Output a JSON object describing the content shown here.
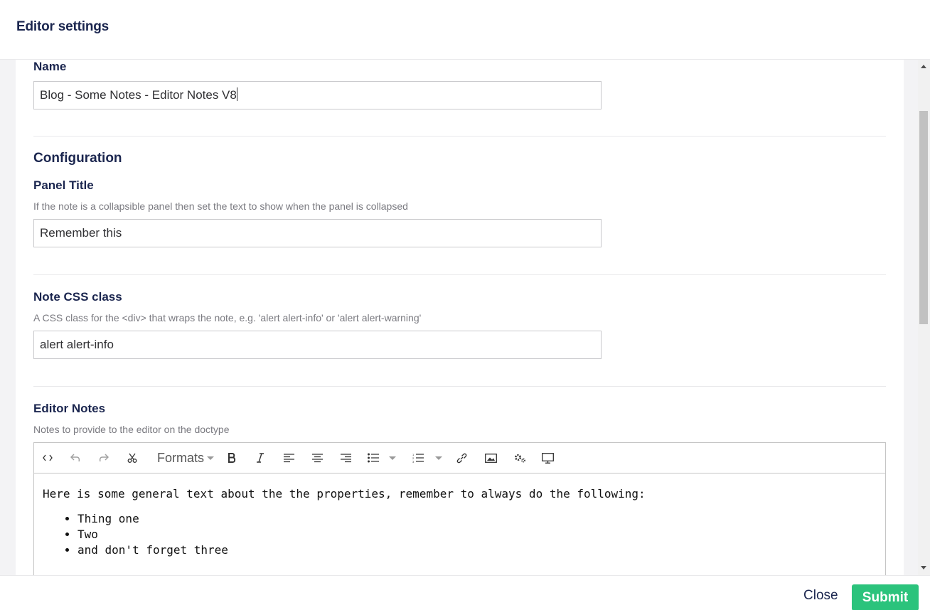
{
  "header": {
    "title": "Editor settings"
  },
  "name_field": {
    "label": "Name",
    "value": "Blog - Some Notes - Editor Notes V8"
  },
  "configuration": {
    "title": "Configuration"
  },
  "panel_title": {
    "label": "Panel Title",
    "description": "If the note is a collapsible panel then set the text to show when the panel is collapsed",
    "value": "Remember this"
  },
  "note_css": {
    "label": "Note CSS class",
    "description": "A CSS class for the <div> that wraps the note, e.g. 'alert alert-info' or 'alert alert-warning'",
    "value": "alert alert-info"
  },
  "editor_notes": {
    "label": "Editor Notes",
    "description": "Notes to provide to the editor on the doctype",
    "toolbar": {
      "formats_label": "Formats",
      "icons": [
        "source-code-icon",
        "undo-icon",
        "redo-icon",
        "cut-icon",
        "bold-icon",
        "italic-icon",
        "align-left-icon",
        "align-center-icon",
        "align-right-icon",
        "bullet-list-icon",
        "numbered-list-icon",
        "link-icon",
        "image-icon",
        "macro-icon",
        "embed-icon"
      ]
    },
    "content": {
      "paragraph": "Here is some general text about the the properties, remember to always do the following:",
      "items": [
        "Thing one",
        "Two",
        "and don't forget three"
      ]
    }
  },
  "footer": {
    "close_label": "Close",
    "submit_label": "Submit"
  },
  "colors": {
    "submit": "#2bc37c",
    "text": "#1b264f",
    "background": "#f3f3f5"
  }
}
